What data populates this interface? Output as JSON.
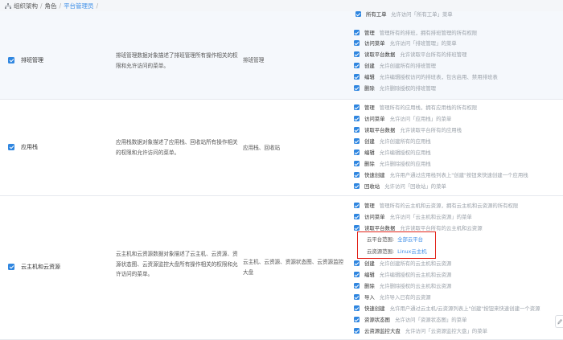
{
  "breadcrumb": {
    "items": [
      "组织架构",
      "角色",
      "平台管理员"
    ],
    "separator": "/"
  },
  "top_partial": {
    "name": "所有工单",
    "desc": "允许访问「所有工单」菜单"
  },
  "rows": [
    {
      "name": "排班管理",
      "description": "排班管理数据对象描述了排班管理所有操作相关的权限和允许访问的菜单。",
      "scope": "排班管理",
      "permissions": [
        {
          "name": "管理",
          "desc": "管理所有的排班，拥有排班管理的所有权限"
        },
        {
          "name": "访问菜单",
          "desc": "允许访问「排班管理」的菜单"
        },
        {
          "name": "读取平台数据",
          "desc": "允许读取平台所有的排班管理"
        },
        {
          "name": "创建",
          "desc": "允许创建所有的排班管理"
        },
        {
          "name": "编辑",
          "desc": "允许编辑授权访问的排班表，包含启用、禁用排班表"
        },
        {
          "name": "删除",
          "desc": "允许删除授权的排班管理"
        }
      ]
    },
    {
      "name": "应用栈",
      "description": "应用栈数据对象描述了应用栈、回收站所有操作相关的权限和允许访问的菜单。",
      "scope": "应用栈、回收站",
      "permissions": [
        {
          "name": "管理",
          "desc": "管理所有的应用栈，拥有应用栈的所有权限"
        },
        {
          "name": "访问菜单",
          "desc": "允许访问「应用栈」的菜单"
        },
        {
          "name": "读取平台数据",
          "desc": "允许读取平台所有的应用栈"
        },
        {
          "name": "创建",
          "desc": "允许创建所有的应用栈"
        },
        {
          "name": "编辑",
          "desc": "允许编辑授权的应用栈"
        },
        {
          "name": "删除",
          "desc": "允许删除授权的应用栈"
        },
        {
          "name": "快速创建",
          "desc": "允许用户通过应用栈列表上\"创建\"按钮来快速创建一个应用栈"
        },
        {
          "name": "回收站",
          "desc": "允许访问「回收站」的菜单"
        }
      ]
    },
    {
      "name": "云主机和云资源",
      "description": "云主机和云资源数据对象描述了云主机、云资源、资源状态图、云资源监控大盘所有操作相关的权限和允许访问的菜单。",
      "scope": "云主机、云资源、资源状态图、云资源监控大盘",
      "permissions_top": [
        {
          "name": "管理",
          "desc": "管理所有的云主机和云资源，拥有云主机和云资源的所有权限"
        },
        {
          "name": "访问菜单",
          "desc": "允许访问「云主机和云资源」的菜单"
        },
        {
          "name": "读取平台数据",
          "desc": "允许读取平台所有的云主机和云资源"
        }
      ],
      "ranges": [
        {
          "label": "云平台范围:",
          "value": "全部云平台"
        },
        {
          "label": "云资源范围:",
          "value": "Linux云主机"
        }
      ],
      "permissions_bottom": [
        {
          "name": "创建",
          "desc": "允许创建所有的云主机和云资源"
        },
        {
          "name": "编辑",
          "desc": "允许编辑授权的云主机和云资源"
        },
        {
          "name": "删除",
          "desc": "允许删除授权的云主机和云资源"
        },
        {
          "name": "导入",
          "desc": "允许导入已有的云资源"
        },
        {
          "name": "快速创建",
          "desc": "允许用户通过云主机/云资源列表上\"创建\"按钮来快速创建一个资源"
        },
        {
          "name": "资源状态图",
          "desc": "允许访问「资源状态图」的菜单"
        },
        {
          "name": "云资源监控大盘",
          "desc": "允许访问「云资源监控大盘」的菜单"
        }
      ]
    }
  ],
  "colors": {
    "accent": "#2f86e0",
    "link": "#3d8ee8",
    "highlight_box": "#e2231a",
    "row_alt_bg": "#f5f8fc"
  },
  "icons": {
    "breadcrumb_home": "org-chart-icon",
    "float": "float-tool-icon"
  }
}
